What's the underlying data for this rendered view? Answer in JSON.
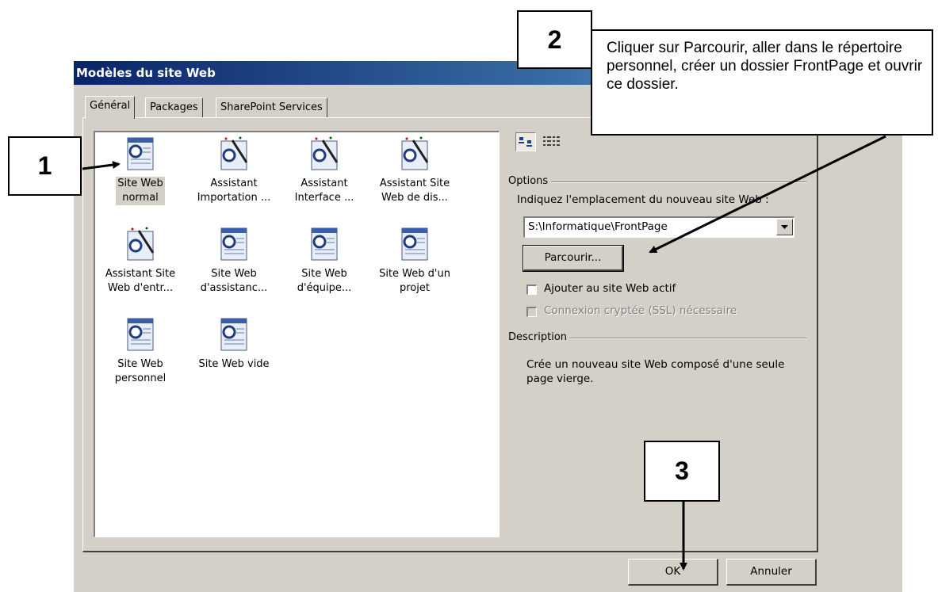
{
  "dialog": {
    "title": "Modèles du site Web",
    "tabs": [
      "Général",
      "Packages",
      "SharePoint Services"
    ],
    "active_tab": "Général"
  },
  "templates": [
    {
      "label_line1": "Site Web",
      "label_line2": "normal",
      "icon": "web-page-icon",
      "selected": true
    },
    {
      "label_line1": "Assistant",
      "label_line2": "Importation ...",
      "icon": "wizard-icon"
    },
    {
      "label_line1": "Assistant",
      "label_line2": "Interface ...",
      "icon": "wizard-icon"
    },
    {
      "label_line1": "Assistant Site",
      "label_line2": "Web de dis...",
      "icon": "wizard-icon"
    },
    {
      "label_line1": "Assistant Site",
      "label_line2": "Web d'entr...",
      "icon": "wizard-icon"
    },
    {
      "label_line1": "Site Web",
      "label_line2": "d'assistanc...",
      "icon": "web-page-icon"
    },
    {
      "label_line1": "Site Web",
      "label_line2": "d'équipe...",
      "icon": "web-page-icon"
    },
    {
      "label_line1": "Site Web d'un",
      "label_line2": "projet",
      "icon": "web-page-icon"
    },
    {
      "label_line1": "Site Web",
      "label_line2": "personnel",
      "icon": "web-page-icon"
    },
    {
      "label_line1": "Site Web vide",
      "label_line2": "",
      "icon": "web-page-icon"
    }
  ],
  "options": {
    "group_label": "Options",
    "location_label": "Indiquez l'emplacement du nouveau site Web :",
    "location_value": "S:\\Informatique\\FrontPage",
    "browse_label": "Parcourir...",
    "add_to_current_label": "Ajouter au site Web actif",
    "ssl_label": "Connexion cryptée (SSL) nécessaire"
  },
  "description": {
    "group_label": "Description",
    "text": "Crée un nouveau site Web composé d'une seule page vierge."
  },
  "buttons": {
    "ok": "OK",
    "cancel": "Annuler"
  },
  "callouts": {
    "step1": "1",
    "step2": "2",
    "step2_text": "Cliquer sur Parcourir, aller dans le répertoire personnel, créer un dossier FrontPage et ouvrir ce dossier.",
    "step3": "3"
  }
}
